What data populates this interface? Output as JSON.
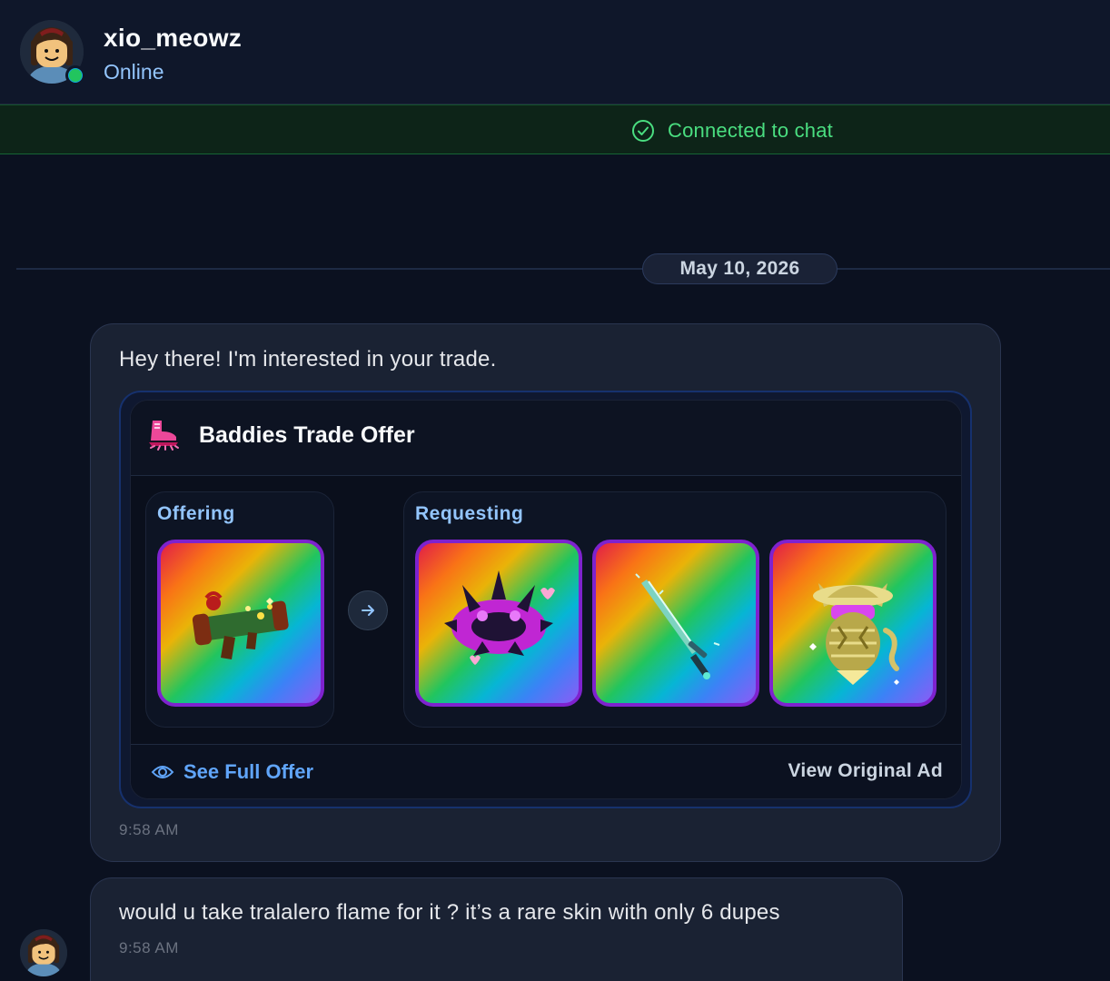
{
  "header": {
    "username": "xio_meowz",
    "presence": "Online",
    "avatar_icon": "avatar-girl-icon",
    "status_color": "#22c55e"
  },
  "banner": {
    "text": "Connected to chat",
    "icon": "check-circle-icon",
    "color": "#4ade80"
  },
  "date_divider": "May 10, 2026",
  "messages": [
    {
      "text": "Hey there! I'm interested in your trade.",
      "time": "9:58 AM",
      "trade_card": {
        "title": "Baddies Trade Offer",
        "icon": "roller-skate-icon",
        "offering_label": "Offering",
        "requesting_label": "Requesting",
        "offering_items": [
          "rocket-launcher-item-icon"
        ],
        "requesting_items": [
          "spiked-crown-item-icon",
          "sword-item-icon",
          "golden-cat-item-icon"
        ],
        "see_full_label": "See Full Offer",
        "view_ad_label": "View Original Ad"
      }
    },
    {
      "text": "would u take tralalero flame for it ? it’s a rare skin with only 6 dupes",
      "time": "9:58 AM"
    }
  ]
}
